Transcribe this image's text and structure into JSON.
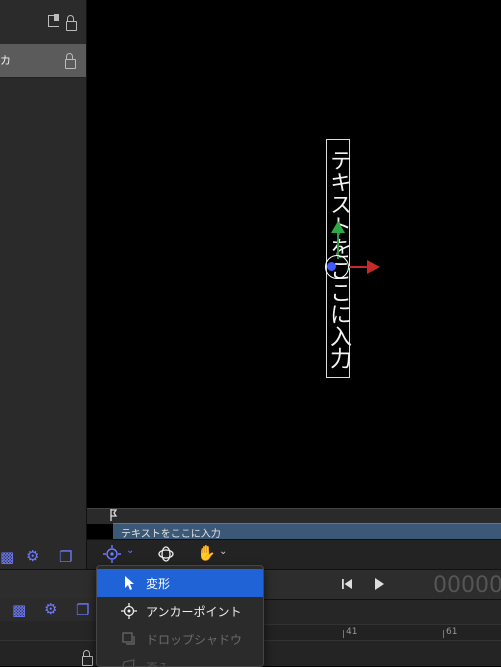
{
  "layers": {
    "row1_label": "カ"
  },
  "canvas": {
    "text": "テキストをここに入力"
  },
  "timeline": {
    "clip_label": "テキストをここに入力"
  },
  "transport": {
    "timecode": "00000"
  },
  "bottom_ruler": {
    "tick_41": "41",
    "tick_61": "61"
  },
  "menu": {
    "items": [
      {
        "label": "変形",
        "icon": "arrow-pointer-icon",
        "state": "selected"
      },
      {
        "label": "アンカーポイント",
        "icon": "anchor-point-icon",
        "state": "enabled"
      },
      {
        "label": "ドロップシャドウ",
        "icon": "drop-shadow-icon",
        "state": "disabled"
      },
      {
        "label": "歪み",
        "icon": "distort-icon",
        "state": "disabled"
      }
    ]
  },
  "colors": {
    "accent": "#6e7bff",
    "menu_selected": "#1f63d6",
    "clip_bar": "#3c5877",
    "x_axis": "#c52a2a",
    "y_axis": "#2eaa45",
    "z_axis": "#3d5bff"
  }
}
